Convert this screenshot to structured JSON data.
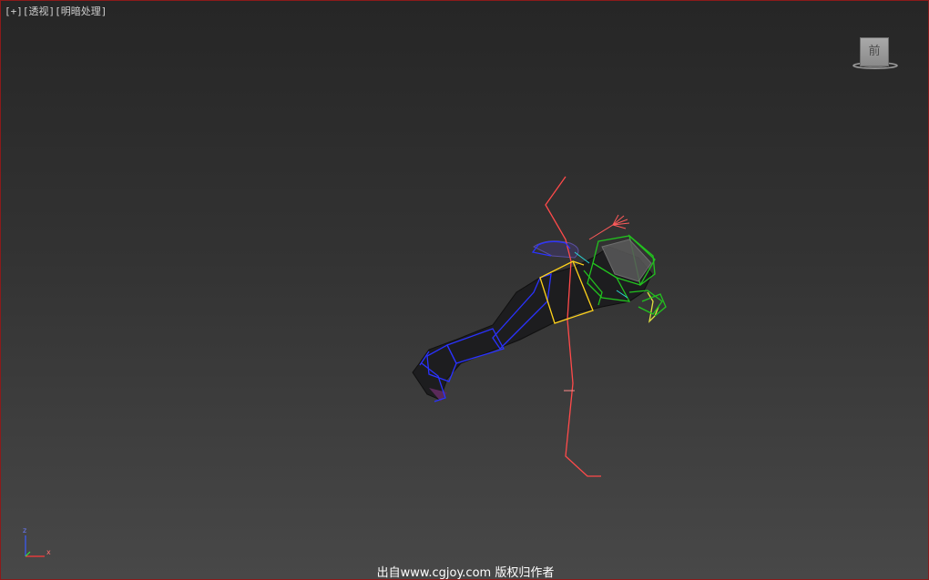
{
  "viewport": {
    "labels": {
      "plus": "[+]",
      "view": "[透视]",
      "shading": "[明暗处理]"
    },
    "viewcube": {
      "face_label": "前"
    },
    "axis": {
      "z": "z",
      "x": "x"
    },
    "watermark": "出自www.cgjoy.com 版权归作者",
    "colors": {
      "border": "#8c1a1a",
      "bone_red": "#ff4a4a",
      "bone_blue": "#2a32ff",
      "bone_green": "#22c21e",
      "bone_yellow": "#ffd21a"
    }
  }
}
